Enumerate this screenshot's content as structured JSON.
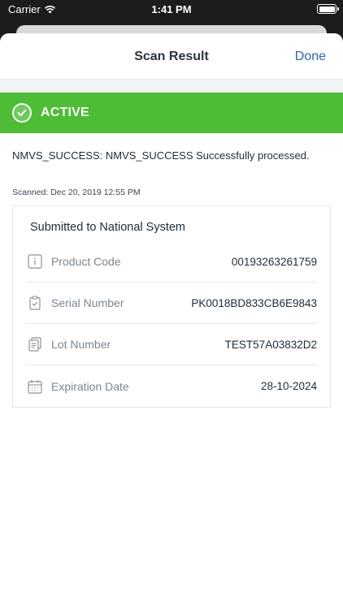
{
  "status_bar": {
    "carrier": "Carrier",
    "time": "1:41 PM"
  },
  "nav": {
    "title": "Scan Result",
    "done_label": "Done"
  },
  "status": {
    "label": "ACTIVE",
    "color": "#4cbd34"
  },
  "message": "NMVS_SUCCESS: NMVS_SUCCESS Successfully processed.",
  "scanned": "Scanned: Dec 20, 2019 12:55 PM",
  "panel": {
    "title": "Submitted to National System",
    "rows": [
      {
        "icon": "info-icon",
        "label": "Product Code",
        "value": "00193263261759"
      },
      {
        "icon": "clipboard-check-icon",
        "label": "Serial Number",
        "value": "PK0018BD833CB6E9843"
      },
      {
        "icon": "documents-icon",
        "label": "Lot Number",
        "value": "TEST57A03832D2"
      },
      {
        "icon": "calendar-icon",
        "label": "Expiration Date",
        "value": "28-10-2024"
      }
    ]
  },
  "colors": {
    "accent": "#2e63b8",
    "success": "#4cbd34"
  }
}
